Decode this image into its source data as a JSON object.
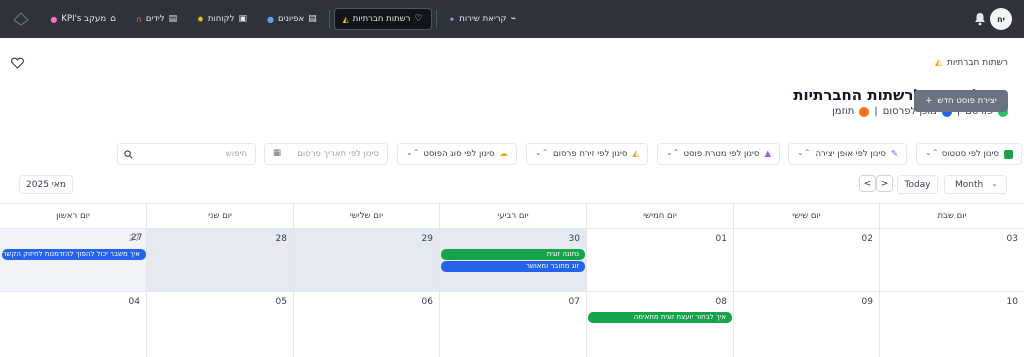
{
  "nav": {
    "avatar": "יח",
    "items": [
      {
        "label": "קריאת שירות",
        "icon": "activity-icon"
      },
      {
        "label": "רשתות חברתיות",
        "icon": "heart-icon"
      },
      {
        "label": "אפיונים",
        "icon": "document-icon"
      },
      {
        "label": "לקוחות",
        "icon": "clipboard-icon"
      },
      {
        "label": "לידים",
        "icon": "document-icon"
      },
      {
        "label": "מעקב KPI's",
        "icon": "home-icon"
      }
    ]
  },
  "breadcrumb": "רשתות חברתיות",
  "title": "ניהול התוכן לרשתות החברתיות",
  "legend": {
    "published": "פורסם",
    "ready": "מוכן לפרסום",
    "scheduled": "תוזמן",
    "separator": "|"
  },
  "colors": {
    "published": "#22c55e",
    "ready": "#2563eb",
    "scheduled": "#f97316"
  },
  "create_button": "יצירת פוסט חדש",
  "create_plus": "+",
  "filters": {
    "status": "סינון לפי סטטוס",
    "creation": "סינון לפי אופן יצירה",
    "goal": "סינון לפי מטרת פוסט",
    "platform": "סינון לפי זירת פרסום",
    "type": "סינון לפי סוג הפוסט",
    "date_placeholder": "סינון לפי תאריך פרסום",
    "search_placeholder": "חיפוש"
  },
  "toolbar": {
    "month_label": "מאי 2025",
    "today": "Today",
    "view": "Month",
    "prev": "<",
    "next": ">"
  },
  "weekdays": [
    "יום ראשון",
    "יום שני",
    "יום שלישי",
    "יום רביעי",
    "יום חמישי",
    "יום שישי",
    "יום שבת"
  ],
  "weeks": [
    [
      "27",
      "28",
      "29",
      "30",
      "01",
      "02",
      "03"
    ],
    [
      "04",
      "05",
      "06",
      "07",
      "08",
      "09",
      "10"
    ]
  ],
  "events": {
    "e1": "איך משבר יכול להפוך להזדמנות לחיזוק הקשר",
    "e2": "נתונה זוגית",
    "e3": "זוג מחובר ומאושר",
    "e4": "איך לבחור יועצת זוגית מתאימה"
  }
}
